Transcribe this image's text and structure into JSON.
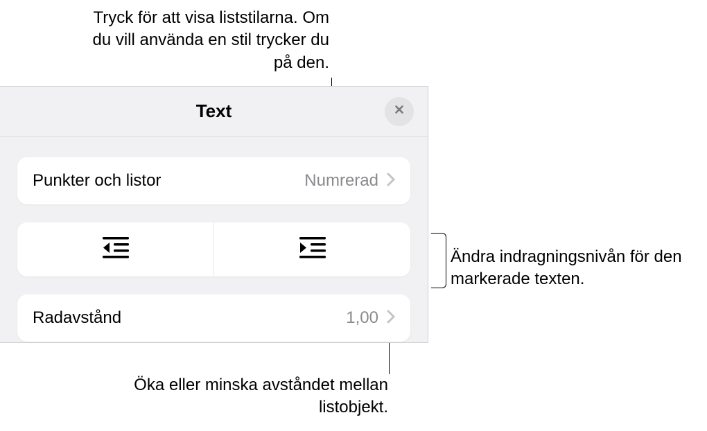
{
  "callouts": {
    "top": "Tryck för att visa liststilarna. Om du vill använda en stil trycker du på den.",
    "right": "Ändra indragningsnivån för den markerade texten.",
    "bottom": "Öka eller minska avståndet mellan listobjekt."
  },
  "panel": {
    "title": "Text",
    "bullets_row": {
      "label": "Punkter och listor",
      "value": "Numrerad"
    },
    "line_spacing_row": {
      "label": "Radavstånd",
      "value": "1,00"
    }
  }
}
